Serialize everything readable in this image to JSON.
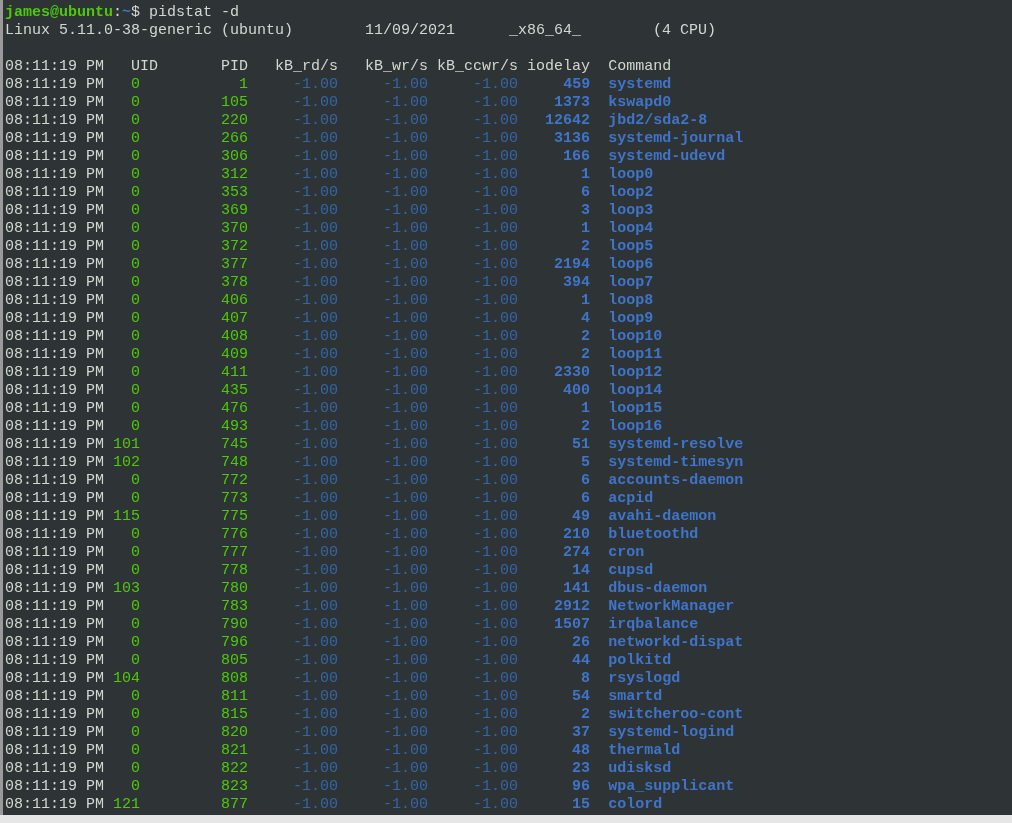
{
  "prompt": {
    "user_host": "james@ubuntu",
    "separator": ":",
    "path": "~",
    "command": "$ pidstat -d"
  },
  "system_info": [
    "Linux 5.11.0-38-generic (ubuntu)",
    "11/09/2021",
    "_x86_64_",
    "(4 CPU)"
  ],
  "columns": [
    "08:11:19 PM",
    "UID",
    "PID",
    "kB_rd/s",
    "kB_wr/s",
    "kB_ccwr/s",
    "iodelay",
    "Command"
  ],
  "rows": [
    [
      "08:11:19 PM",
      "0",
      "1",
      "-1.00",
      "-1.00",
      "-1.00",
      "459",
      "systemd"
    ],
    [
      "08:11:19 PM",
      "0",
      "105",
      "-1.00",
      "-1.00",
      "-1.00",
      "1373",
      "kswapd0"
    ],
    [
      "08:11:19 PM",
      "0",
      "220",
      "-1.00",
      "-1.00",
      "-1.00",
      "12642",
      "jbd2/sda2-8"
    ],
    [
      "08:11:19 PM",
      "0",
      "266",
      "-1.00",
      "-1.00",
      "-1.00",
      "3136",
      "systemd-journal"
    ],
    [
      "08:11:19 PM",
      "0",
      "306",
      "-1.00",
      "-1.00",
      "-1.00",
      "166",
      "systemd-udevd"
    ],
    [
      "08:11:19 PM",
      "0",
      "312",
      "-1.00",
      "-1.00",
      "-1.00",
      "1",
      "loop0"
    ],
    [
      "08:11:19 PM",
      "0",
      "353",
      "-1.00",
      "-1.00",
      "-1.00",
      "6",
      "loop2"
    ],
    [
      "08:11:19 PM",
      "0",
      "369",
      "-1.00",
      "-1.00",
      "-1.00",
      "3",
      "loop3"
    ],
    [
      "08:11:19 PM",
      "0",
      "370",
      "-1.00",
      "-1.00",
      "-1.00",
      "1",
      "loop4"
    ],
    [
      "08:11:19 PM",
      "0",
      "372",
      "-1.00",
      "-1.00",
      "-1.00",
      "2",
      "loop5"
    ],
    [
      "08:11:19 PM",
      "0",
      "377",
      "-1.00",
      "-1.00",
      "-1.00",
      "2194",
      "loop6"
    ],
    [
      "08:11:19 PM",
      "0",
      "378",
      "-1.00",
      "-1.00",
      "-1.00",
      "394",
      "loop7"
    ],
    [
      "08:11:19 PM",
      "0",
      "406",
      "-1.00",
      "-1.00",
      "-1.00",
      "1",
      "loop8"
    ],
    [
      "08:11:19 PM",
      "0",
      "407",
      "-1.00",
      "-1.00",
      "-1.00",
      "4",
      "loop9"
    ],
    [
      "08:11:19 PM",
      "0",
      "408",
      "-1.00",
      "-1.00",
      "-1.00",
      "2",
      "loop10"
    ],
    [
      "08:11:19 PM",
      "0",
      "409",
      "-1.00",
      "-1.00",
      "-1.00",
      "2",
      "loop11"
    ],
    [
      "08:11:19 PM",
      "0",
      "411",
      "-1.00",
      "-1.00",
      "-1.00",
      "2330",
      "loop12"
    ],
    [
      "08:11:19 PM",
      "0",
      "435",
      "-1.00",
      "-1.00",
      "-1.00",
      "400",
      "loop14"
    ],
    [
      "08:11:19 PM",
      "0",
      "476",
      "-1.00",
      "-1.00",
      "-1.00",
      "1",
      "loop15"
    ],
    [
      "08:11:19 PM",
      "0",
      "493",
      "-1.00",
      "-1.00",
      "-1.00",
      "2",
      "loop16"
    ],
    [
      "08:11:19 PM",
      "101",
      "745",
      "-1.00",
      "-1.00",
      "-1.00",
      "51",
      "systemd-resolve"
    ],
    [
      "08:11:19 PM",
      "102",
      "748",
      "-1.00",
      "-1.00",
      "-1.00",
      "5",
      "systemd-timesyn"
    ],
    [
      "08:11:19 PM",
      "0",
      "772",
      "-1.00",
      "-1.00",
      "-1.00",
      "6",
      "accounts-daemon"
    ],
    [
      "08:11:19 PM",
      "0",
      "773",
      "-1.00",
      "-1.00",
      "-1.00",
      "6",
      "acpid"
    ],
    [
      "08:11:19 PM",
      "115",
      "775",
      "-1.00",
      "-1.00",
      "-1.00",
      "49",
      "avahi-daemon"
    ],
    [
      "08:11:19 PM",
      "0",
      "776",
      "-1.00",
      "-1.00",
      "-1.00",
      "210",
      "bluetoothd"
    ],
    [
      "08:11:19 PM",
      "0",
      "777",
      "-1.00",
      "-1.00",
      "-1.00",
      "274",
      "cron"
    ],
    [
      "08:11:19 PM",
      "0",
      "778",
      "-1.00",
      "-1.00",
      "-1.00",
      "14",
      "cupsd"
    ],
    [
      "08:11:19 PM",
      "103",
      "780",
      "-1.00",
      "-1.00",
      "-1.00",
      "141",
      "dbus-daemon"
    ],
    [
      "08:11:19 PM",
      "0",
      "783",
      "-1.00",
      "-1.00",
      "-1.00",
      "2912",
      "NetworkManager"
    ],
    [
      "08:11:19 PM",
      "0",
      "790",
      "-1.00",
      "-1.00",
      "-1.00",
      "1507",
      "irqbalance"
    ],
    [
      "08:11:19 PM",
      "0",
      "796",
      "-1.00",
      "-1.00",
      "-1.00",
      "26",
      "networkd-dispat"
    ],
    [
      "08:11:19 PM",
      "0",
      "805",
      "-1.00",
      "-1.00",
      "-1.00",
      "44",
      "polkitd"
    ],
    [
      "08:11:19 PM",
      "104",
      "808",
      "-1.00",
      "-1.00",
      "-1.00",
      "8",
      "rsyslogd"
    ],
    [
      "08:11:19 PM",
      "0",
      "811",
      "-1.00",
      "-1.00",
      "-1.00",
      "54",
      "smartd"
    ],
    [
      "08:11:19 PM",
      "0",
      "815",
      "-1.00",
      "-1.00",
      "-1.00",
      "2",
      "switcheroo-cont"
    ],
    [
      "08:11:19 PM",
      "0",
      "820",
      "-1.00",
      "-1.00",
      "-1.00",
      "37",
      "systemd-logind"
    ],
    [
      "08:11:19 PM",
      "0",
      "821",
      "-1.00",
      "-1.00",
      "-1.00",
      "48",
      "thermald"
    ],
    [
      "08:11:19 PM",
      "0",
      "822",
      "-1.00",
      "-1.00",
      "-1.00",
      "23",
      "udisksd"
    ],
    [
      "08:11:19 PM",
      "0",
      "823",
      "-1.00",
      "-1.00",
      "-1.00",
      "96",
      "wpa_supplicant"
    ],
    [
      "08:11:19 PM",
      "121",
      "877",
      "-1.00",
      "-1.00",
      "-1.00",
      "15",
      "colord"
    ]
  ]
}
